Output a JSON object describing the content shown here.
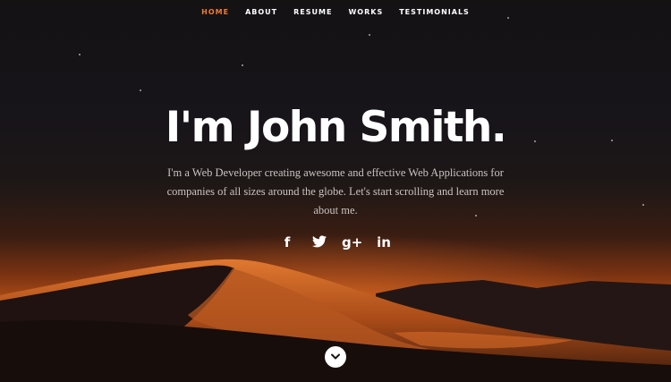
{
  "nav": {
    "items": [
      {
        "label": "HOME",
        "active": true
      },
      {
        "label": "ABOUT"
      },
      {
        "label": "RESUME"
      },
      {
        "label": "WORKS"
      },
      {
        "label": "TESTIMONIALS"
      }
    ]
  },
  "hero": {
    "title": "I'm John Smith.",
    "description": "I'm a Web Developer creating awesome and effective Web Applications for companies of all sizes around the globe. Let's start scrolling and learn more about me."
  },
  "social": {
    "icons": [
      "facebook-icon",
      "twitter-icon",
      "google-plus-icon",
      "linkedin-icon"
    ],
    "facebook_glyph": "f",
    "google_glyph": "g+",
    "linkedin_glyph": "in"
  },
  "scroll": {
    "icon": "chevron-down-icon"
  },
  "colors": {
    "accent": "#ee7a35",
    "text": "#ffffff",
    "body_text": "#c9c3c0"
  }
}
